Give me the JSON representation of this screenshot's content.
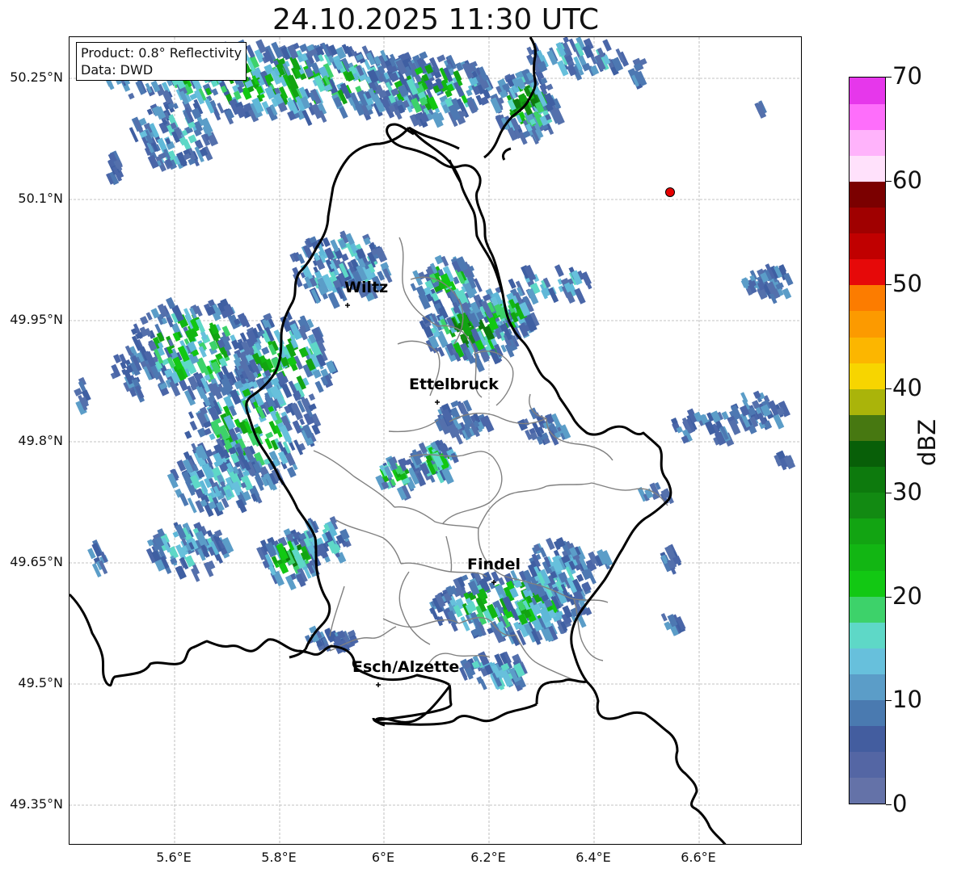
{
  "title": "24.10.2025 11:30 UTC",
  "info": {
    "product": "Product: 0.8° Reflectivity",
    "data": "Data: DWD"
  },
  "y_ticks": [
    "50.25°N",
    "50.1°N",
    "49.95°N",
    "49.8°N",
    "49.65°N",
    "49.5°N",
    "49.35°N"
  ],
  "x_ticks": [
    "5.6°E",
    "5.8°E",
    "6°E",
    "6.2°E",
    "6.4°E",
    "6.6°E"
  ],
  "cities": [
    {
      "name": "Wiltz"
    },
    {
      "name": "Ettelbruck"
    },
    {
      "name": "Findel"
    },
    {
      "name": "Esch/Alzette"
    }
  ],
  "colorbar": {
    "label": "dBZ",
    "ticks": [
      "0",
      "10",
      "20",
      "30",
      "40",
      "50",
      "60",
      "70"
    ],
    "colors": [
      "#6472a8",
      "#5466a4",
      "#435d9f",
      "#4a7ab0",
      "#5b9dc8",
      "#67c0dc",
      "#5ed8c7",
      "#3dd26a",
      "#12c813",
      "#12b613",
      "#12a412",
      "#128a12",
      "#0d7a0d",
      "#085f08",
      "#477811",
      "#aab40a",
      "#f7d500",
      "#fcb600",
      "#fc9a00",
      "#fc7c00",
      "#e60909",
      "#c00000",
      "#a00000",
      "#7b0000",
      "#ffe1fb",
      "#ffb3fb",
      "#fe6efb",
      "#e637eb"
    ]
  },
  "marker": {
    "color": "#e60000"
  },
  "colors": {
    "border": "#000000",
    "canton": "#808080",
    "grid": "#b0b0b0"
  }
}
